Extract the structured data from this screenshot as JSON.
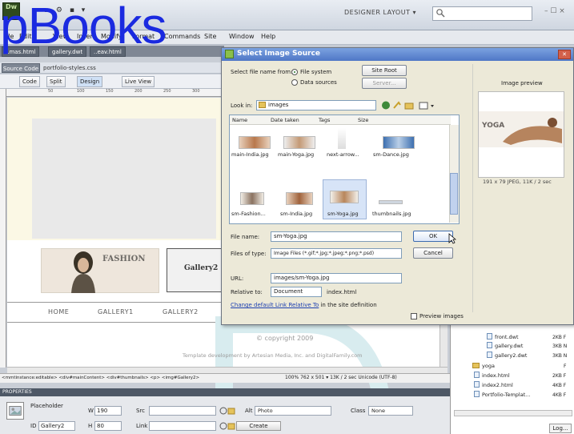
{
  "app": {
    "title_tools": "▪ ▪ ⚙ ▪ ▾",
    "workspace_label": "DESIGNER LAYOUT ▾",
    "window_controls": "– ☐ ×"
  },
  "watermark": {
    "text": "pBooks",
    "color": "#1a2ae0"
  },
  "menu": {
    "items": [
      "File",
      "Edit",
      "View",
      "Insert",
      "Modify",
      "Format",
      "Commands",
      "Site",
      "Window",
      "Help"
    ]
  },
  "document": {
    "tabs": [
      "..mas.html",
      "gallery.dwt",
      "..eav.html"
    ],
    "source_code_tab": "Source Code",
    "related_file": "portfolio-styles.css",
    "toolbar": {
      "code": "Code",
      "split": "Split",
      "design": "Design",
      "live_view": "Live View"
    },
    "ruler_numbers": [
      "50",
      "100",
      "150",
      "200",
      "250",
      "300"
    ],
    "fashion_label": "FASHION",
    "gallery2_label": "Gallery2",
    "nav": [
      "HOME",
      "GALLERY1",
      "GALLERY2"
    ],
    "copyright": "© copyright 2009",
    "template_dev": "Template development by Artesian Media, Inc. and DigitalFamily.com"
  },
  "status": {
    "tag_selector": "<mmtinstance:editable> <div#mainContent> <div#thumbnails> <p> <img#Gallery2>",
    "zoom": "100%",
    "info": "762 x 501 ▾  13K / 2 sec  Unicode (UTF-8)"
  },
  "properties": {
    "header": "PROPERTIES",
    "placeholder_label": "Placeholder",
    "id_label": "ID",
    "id_value": "Gallery2",
    "w_label": "W",
    "w_value": "190",
    "h_label": "H",
    "h_value": "80",
    "src_label": "Src",
    "link_label": "Link",
    "alt_label": "Alt",
    "alt_value": "Photo",
    "class_label": "Class",
    "class_value": "None",
    "create_label": "Create"
  },
  "files": {
    "rows": [
      {
        "name": "front.dwt",
        "size": "2KB F",
        "type": "file"
      },
      {
        "name": "gallery.dwt",
        "size": "3KB N",
        "type": "file"
      },
      {
        "name": "gallery2.dwt",
        "size": "3KB N",
        "type": "file"
      },
      {
        "name": "yoga",
        "size": "F",
        "type": "folder"
      },
      {
        "name": "index.html",
        "size": "2KB F",
        "type": "file"
      },
      {
        "name": "index2.html",
        "size": "4KB F",
        "type": "file"
      },
      {
        "name": "Portfolio-Templat...",
        "size": "4KB F",
        "type": "file"
      }
    ],
    "log_label": "Log..."
  },
  "dialog": {
    "title": "Select Image Source",
    "select_from_label": "Select file name from:",
    "file_system_label": "File system",
    "data_sources_label": "Data sources",
    "site_root_label": "Site Root",
    "server_label": "Server...",
    "look_in_label": "Look in:",
    "look_in_value": "images",
    "columns": [
      "Name",
      "Date taken",
      "Tags",
      "Size"
    ],
    "row1": [
      "main-India.jpg",
      "main-Yoga.jpg",
      "next-arrow...",
      "sm-Dance.jpg"
    ],
    "row2": [
      "sm-Fashion...",
      "sm-India.jpg",
      "sm-Yoga.jpg",
      "thumbnails.jpg"
    ],
    "file_name_label": "File name:",
    "file_name_value": "sm-Yoga.jpg",
    "files_of_type_label": "Files of type:",
    "files_of_type_value": "Image Files (*.gif;*.jpg;*.jpeg;*.png;*.psd)",
    "ok_label": "OK",
    "cancel_label": "Cancel",
    "url_label": "URL:",
    "url_value": "images/sm-Yoga.jpg",
    "relative_to_label": "Relative to:",
    "relative_to_value": "Document",
    "relative_to_file": "index.html",
    "change_default_link": "Change default Link Relative To",
    "change_default_rest": " in the site definition",
    "preview_images_label": "Preview images",
    "image_preview_label": "Image preview",
    "preview_text": "YOGA",
    "preview_caption": "191 x 79 JPEG, 11K / 2 sec"
  }
}
